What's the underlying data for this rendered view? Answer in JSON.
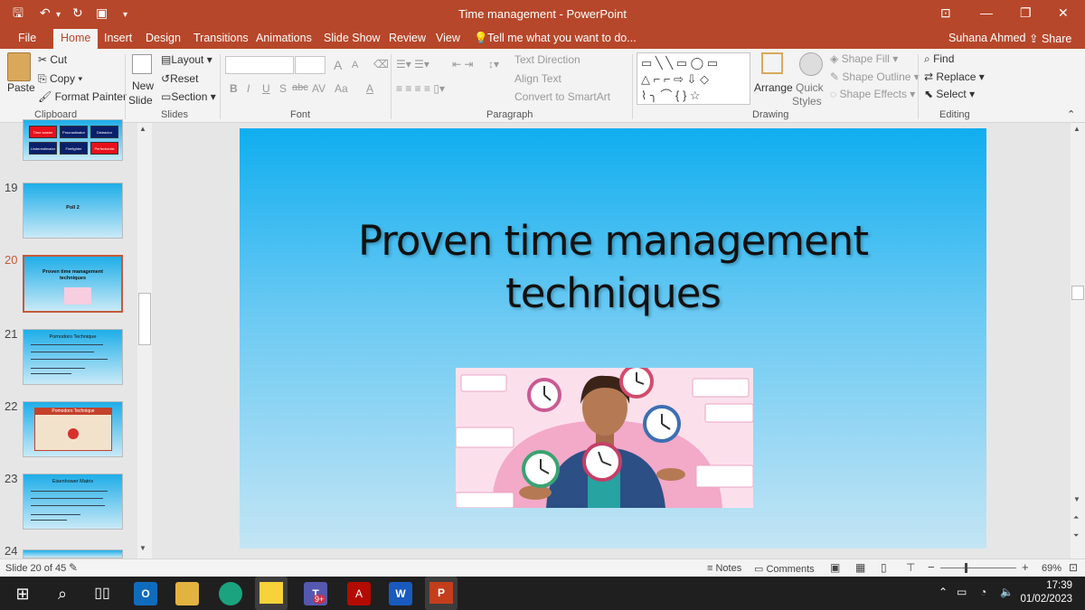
{
  "titlebar": {
    "title": "Time management - PowerPoint",
    "user": "Suhana Ahmed",
    "share": "Share"
  },
  "menu": {
    "tabs": [
      "File",
      "Home",
      "Insert",
      "Design",
      "Transitions",
      "Animations",
      "Slide Show",
      "Review",
      "View"
    ],
    "tell_me": "Tell me what you want to do..."
  },
  "ribbon": {
    "clipboard": {
      "label": "Clipboard",
      "paste": "Paste",
      "cut": "Cut",
      "copy": "Copy",
      "format_painter": "Format Painter"
    },
    "slides": {
      "label": "Slides",
      "new_slide_1": "New",
      "new_slide_2": "Slide",
      "layout": "Layout",
      "reset": "Reset",
      "section": "Section"
    },
    "font": {
      "label": "Font",
      "bold": "B",
      "italic": "I",
      "underline": "U",
      "strike": "S",
      "strike2": "abc",
      "spacing": "AV",
      "case": "Aa",
      "color": "A",
      "grow": "A",
      "shrink": "A"
    },
    "paragraph": {
      "label": "Paragraph",
      "text_direction": "Text Direction",
      "align_text": "Align Text",
      "smartart": "Convert to SmartArt"
    },
    "drawing": {
      "label": "Drawing",
      "arrange": "Arrange",
      "quick_1": "Quick",
      "quick_2": "Styles",
      "fill": "Shape Fill",
      "outline": "Shape Outline",
      "effects": "Shape Effects"
    },
    "editing": {
      "label": "Editing",
      "find": "Find",
      "replace": "Replace",
      "select": "Select"
    }
  },
  "thumbnails": [
    {
      "num": "19",
      "text": "Poll 2"
    },
    {
      "num": "20",
      "text": "Proven time management techniques"
    },
    {
      "num": "21",
      "text": "Pomodoro Technique"
    },
    {
      "num": "22",
      "text": "Pomodoro Technique"
    },
    {
      "num": "23",
      "text": "Eisenhower Matrix"
    },
    {
      "num": "24",
      "text": ""
    }
  ],
  "thumb18": [
    "Time waster",
    "Procrastinator",
    "Distractor",
    "Underestimator",
    "Firefighter",
    "Perfectionist"
  ],
  "slide": {
    "title_line1": "Proven time management",
    "title_line2": "techniques"
  },
  "status": {
    "slide_count": "Slide 20 of 45",
    "notes": "Notes",
    "comments": "Comments",
    "zoom": "69%"
  },
  "taskbar": {
    "time": "17:39",
    "date": "01/02/2023",
    "teams_badge": "9+"
  },
  "colors": {
    "accent": "#b7472a",
    "slide_top": "#10aeef",
    "slide_bottom": "#c3e5f4"
  }
}
